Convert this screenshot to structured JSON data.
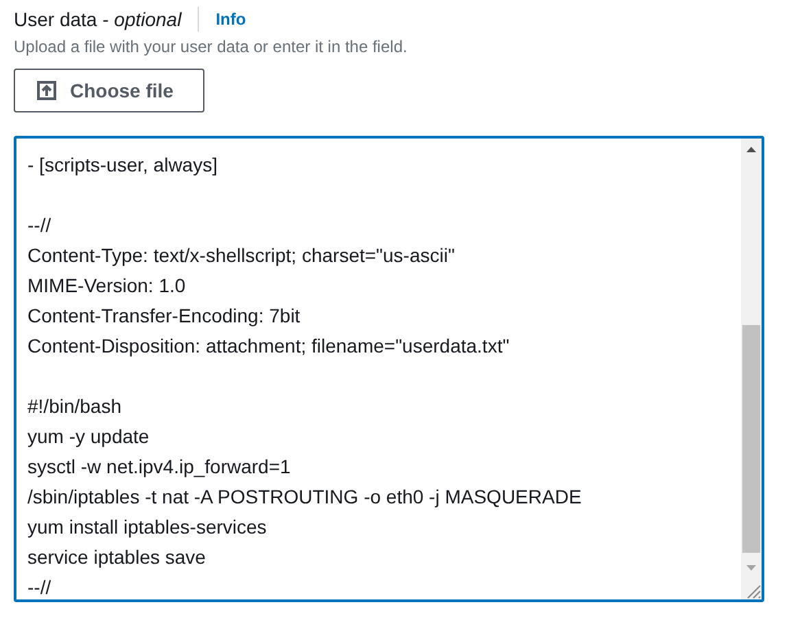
{
  "label": {
    "text": "User data",
    "separator": " - ",
    "optional": "optional"
  },
  "info_link": "Info",
  "description": "Upload a file with your user data or enter it in the field.",
  "choose_button": "Choose file",
  "editor": {
    "blocks": [
      [
        "- [scripts-user, always]"
      ],
      [
        "--//",
        "Content-Type: text/x-shellscript; charset=\"us-ascii\"",
        "MIME-Version: 1.0",
        "Content-Transfer-Encoding: 7bit",
        "Content-Disposition: attachment; filename=\"userdata.txt\""
      ],
      [
        "#!/bin/bash",
        "yum -y update",
        "sysctl -w net.ipv4.ip_forward=1",
        "/sbin/iptables -t nat -A POSTROUTING -o eth0 -j MASQUERADE",
        "yum install iptables-services",
        "service iptables save",
        "--//"
      ]
    ],
    "focused": true
  }
}
